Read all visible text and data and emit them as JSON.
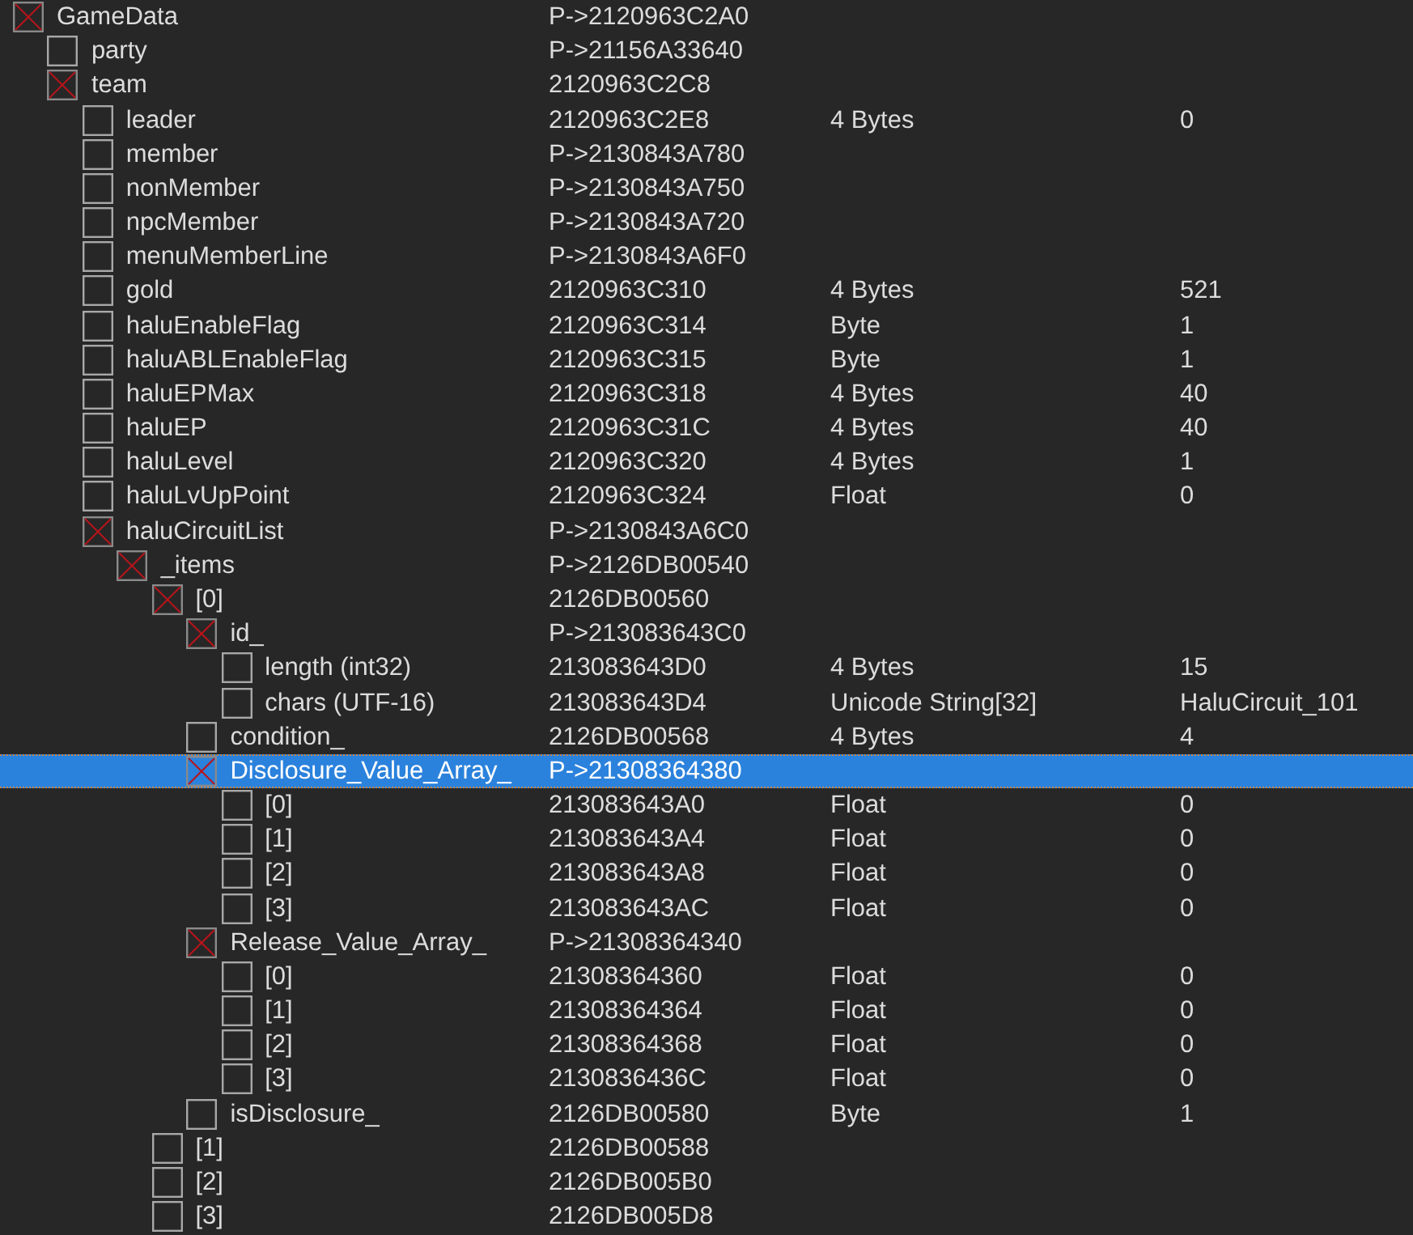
{
  "tree": {
    "nodes": [
      {
        "name": "GameData",
        "address": "P->2120963C2A0",
        "expanded": true,
        "selected": false,
        "children": [
          {
            "name": "party",
            "address": "P->21156A33640",
            "expanded": false,
            "selected": false
          },
          {
            "name": "team",
            "address": "2120963C2C8",
            "expanded": true,
            "selected": false,
            "children": [
              {
                "name": "leader",
                "address": "2120963C2E8",
                "type": "4 Bytes",
                "value": "0",
                "expanded": false,
                "selected": false
              },
              {
                "name": "member",
                "address": "P->2130843A780",
                "expanded": false,
                "selected": false
              },
              {
                "name": "nonMember",
                "address": "P->2130843A750",
                "expanded": false,
                "selected": false
              },
              {
                "name": "npcMember",
                "address": "P->2130843A720",
                "expanded": false,
                "selected": false
              },
              {
                "name": "menuMemberLine",
                "address": "P->2130843A6F0",
                "expanded": false,
                "selected": false
              },
              {
                "name": "gold",
                "address": "2120963C310",
                "type": "4 Bytes",
                "value": "521",
                "expanded": false,
                "selected": false
              },
              {
                "name": "haluEnableFlag",
                "address": "2120963C314",
                "type": "Byte",
                "value": "1",
                "expanded": false,
                "selected": false
              },
              {
                "name": "haluABLEnableFlag",
                "address": "2120963C315",
                "type": "Byte",
                "value": "1",
                "expanded": false,
                "selected": false
              },
              {
                "name": "haluEPMax",
                "address": "2120963C318",
                "type": "4 Bytes",
                "value": "40",
                "expanded": false,
                "selected": false
              },
              {
                "name": "haluEP",
                "address": "2120963C31C",
                "type": "4 Bytes",
                "value": "40",
                "expanded": false,
                "selected": false
              },
              {
                "name": "haluLevel",
                "address": "2120963C320",
                "type": "4 Bytes",
                "value": "1",
                "expanded": false,
                "selected": false
              },
              {
                "name": "haluLvUpPoint",
                "address": "2120963C324",
                "type": "Float",
                "value": "0",
                "expanded": false,
                "selected": false
              },
              {
                "name": "haluCircuitList",
                "address": "P->2130843A6C0",
                "expanded": true,
                "selected": false,
                "children": [
                  {
                    "name": "_items",
                    "address": "P->2126DB00540",
                    "expanded": true,
                    "selected": false,
                    "children": [
                      {
                        "name": "[0]",
                        "address": "2126DB00560",
                        "expanded": true,
                        "selected": false,
                        "children": [
                          {
                            "name": "id_",
                            "address": "P->213083643C0",
                            "expanded": true,
                            "selected": false,
                            "children": [
                              {
                                "name": "length (int32)",
                                "address": "213083643D0",
                                "type": "4 Bytes",
                                "value": "15",
                                "expanded": false,
                                "selected": false
                              },
                              {
                                "name": "chars (UTF-16)",
                                "address": "213083643D4",
                                "type": "Unicode String[32]",
                                "value": "HaluCircuit_101",
                                "expanded": false,
                                "selected": false
                              }
                            ]
                          },
                          {
                            "name": "condition_",
                            "address": "2126DB00568",
                            "type": "4 Bytes",
                            "value": "4",
                            "expanded": false,
                            "selected": false
                          },
                          {
                            "name": "Disclosure_Value_Array_",
                            "address": "P->21308364380",
                            "expanded": true,
                            "selected": true,
                            "children": [
                              {
                                "name": "[0]",
                                "address": "213083643A0",
                                "type": "Float",
                                "value": "0",
                                "expanded": false,
                                "selected": false
                              },
                              {
                                "name": "[1]",
                                "address": "213083643A4",
                                "type": "Float",
                                "value": "0",
                                "expanded": false,
                                "selected": false
                              },
                              {
                                "name": "[2]",
                                "address": "213083643A8",
                                "type": "Float",
                                "value": "0",
                                "expanded": false,
                                "selected": false
                              },
                              {
                                "name": "[3]",
                                "address": "213083643AC",
                                "type": "Float",
                                "value": "0",
                                "expanded": false,
                                "selected": false
                              }
                            ]
                          },
                          {
                            "name": "Release_Value_Array_",
                            "address": "P->21308364340",
                            "expanded": true,
                            "selected": false,
                            "children": [
                              {
                                "name": "[0]",
                                "address": "21308364360",
                                "type": "Float",
                                "value": "0",
                                "expanded": false,
                                "selected": false
                              },
                              {
                                "name": "[1]",
                                "address": "21308364364",
                                "type": "Float",
                                "value": "0",
                                "expanded": false,
                                "selected": false
                              },
                              {
                                "name": "[2]",
                                "address": "21308364368",
                                "type": "Float",
                                "value": "0",
                                "expanded": false,
                                "selected": false
                              },
                              {
                                "name": "[3]",
                                "address": "2130836436C",
                                "type": "Float",
                                "value": "0",
                                "expanded": false,
                                "selected": false
                              }
                            ]
                          },
                          {
                            "name": "isDisclosure_",
                            "address": "2126DB00580",
                            "type": "Byte",
                            "value": "1",
                            "expanded": false,
                            "selected": false
                          }
                        ]
                      },
                      {
                        "name": "[1]",
                        "address": "2126DB00588",
                        "expanded": false,
                        "selected": false
                      },
                      {
                        "name": "[2]",
                        "address": "2126DB005B0",
                        "expanded": false,
                        "selected": false
                      },
                      {
                        "name": "[3]",
                        "address": "2126DB005D8",
                        "expanded": false,
                        "selected": false
                      }
                    ]
                  }
                ]
              }
            ]
          }
        ]
      }
    ]
  }
}
